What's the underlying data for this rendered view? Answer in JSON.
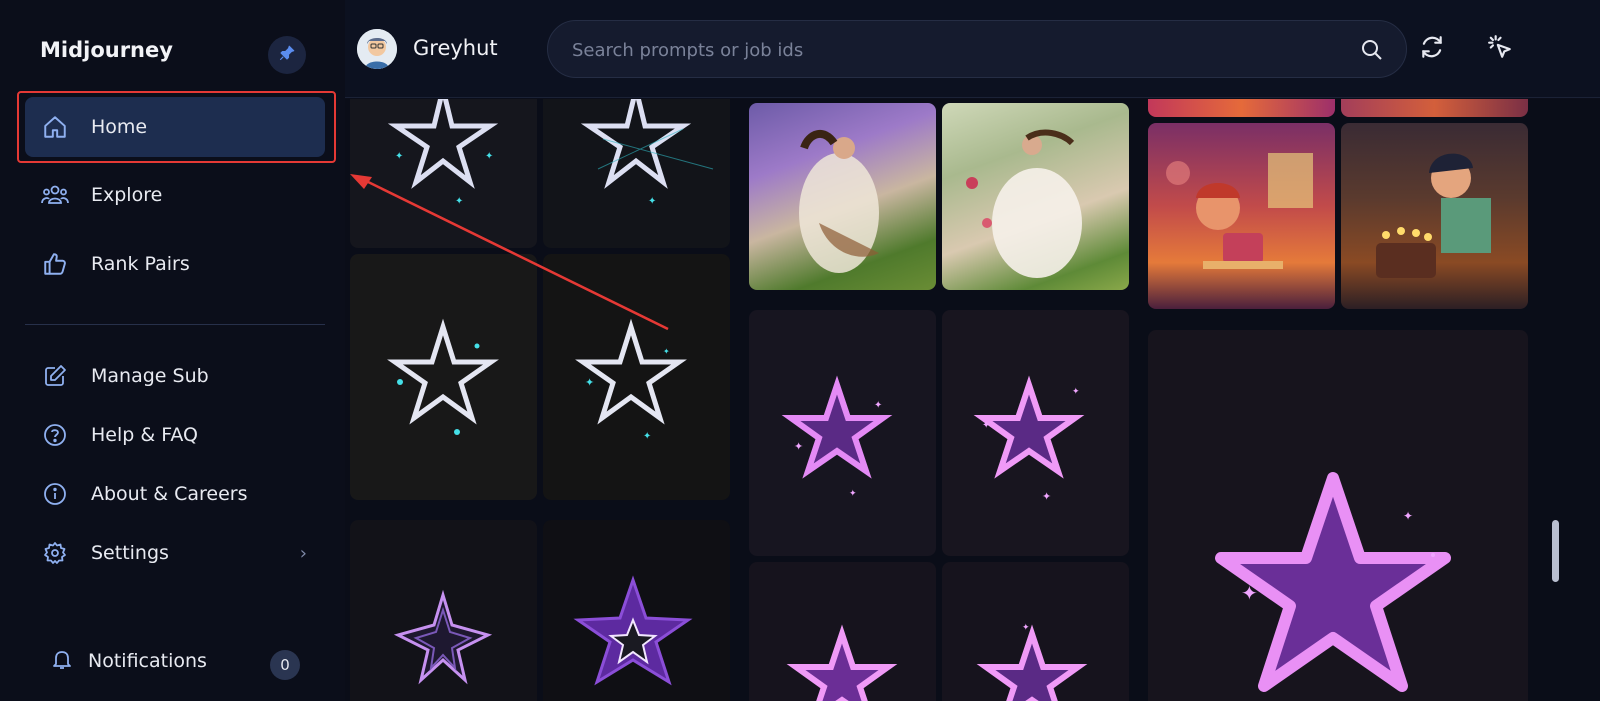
{
  "sidebar": {
    "brand": "Midjourney",
    "items": [
      {
        "label": "Home",
        "icon": "home-icon",
        "active": true
      },
      {
        "label": "Explore",
        "icon": "people-icon"
      },
      {
        "label": "Rank Pairs",
        "icon": "thumbs-up-icon"
      },
      {
        "label": "Manage Sub",
        "icon": "edit-icon"
      },
      {
        "label": "Help & FAQ",
        "icon": "help-icon"
      },
      {
        "label": "About & Careers",
        "icon": "info-icon"
      },
      {
        "label": "Settings",
        "icon": "gear-icon"
      }
    ],
    "notifications": {
      "label": "Notifications",
      "count": "0"
    }
  },
  "header": {
    "username": "Greyhut",
    "search_placeholder": "Search prompts or job ids"
  },
  "colors": {
    "accent_active": "#1d2d4f",
    "annotation_red": "#e53935",
    "background": "#0b0e1a"
  }
}
